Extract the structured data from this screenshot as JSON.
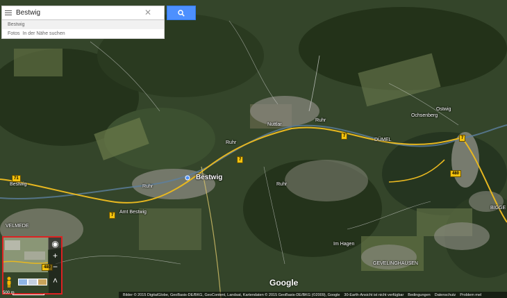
{
  "search": {
    "query": "Bestwig",
    "clear_glyph": "✕"
  },
  "suggestions": [
    {
      "text": "Bestwig",
      "extra": ""
    },
    {
      "text": "Fotos",
      "extra": "In der Nähe suchen"
    }
  ],
  "places": {
    "bestwig": "Bestwig",
    "nuttlar": "Nuttlar",
    "dumel": "DÜMEL",
    "ostwig": "Ostwig",
    "ochsenberg": "Ochsenberg",
    "amt_bestwig": "Amt Bestwig",
    "im_hagen": "Im Hagen",
    "velmede": "VELMEDE",
    "gevelinghausen": "GEVELINGHAUSEN",
    "bigge": "BIGGE",
    "bestwig_west": "Bestwig",
    "ruhr_1": "Ruhr",
    "ruhr_2": "Ruhr",
    "ruhr_3": "Ruhr",
    "ruhr_4": "Ruhr"
  },
  "road_shields": [
    "7",
    "7",
    "7",
    "7",
    "71",
    "480",
    "480"
  ],
  "controls": {
    "zoom_in": "+",
    "zoom_out": "−",
    "expand": "˄",
    "compass": "◉"
  },
  "scale": {
    "label": "500 m"
  },
  "brand": "Google",
  "attribution": {
    "imagery": "Bilder © 2015 DigitalGlobe, GeoBasis-DE/BKG, GeoContent, Landsat, Kartendaten © 2015 GeoBasis-DE/BKG (©2009), Google",
    "earth": "30-Earth-Ansicht ist nicht verfügbar",
    "terms": "Bedingungen",
    "privacy": "Datenschutz",
    "report": "Problem mel"
  },
  "colors": {
    "search_button": "#4d90fe",
    "highlight_border": "#dd2222",
    "road": "#f4c20d"
  }
}
